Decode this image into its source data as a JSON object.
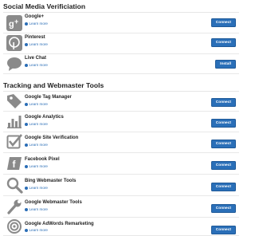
{
  "colors": {
    "accent": "#2a6fb8",
    "icon_gray": "#8a8a8a",
    "link_blue": "#2a6db6"
  },
  "social": {
    "title": "Social Media Verificiation",
    "items": [
      {
        "icon": "google-plus-icon",
        "name": "Google+",
        "learn": "Learn more",
        "action": "Connect"
      },
      {
        "icon": "pinterest-icon",
        "name": "Pinterest",
        "learn": "Learn more",
        "action": "Connect"
      },
      {
        "icon": "chat-bubble-icon",
        "name": "Live Chat",
        "learn": "Learn more",
        "action": "Install"
      }
    ]
  },
  "tracking": {
    "title": "Tracking and Webmaster Tools",
    "items": [
      {
        "icon": "tag-icon",
        "name": "Google Tag Manager",
        "learn": "Learn more",
        "action": "Connect"
      },
      {
        "icon": "bar-chart-icon",
        "name": "Google Analytics",
        "learn": "Learn more",
        "action": "Connect"
      },
      {
        "icon": "checkbox-icon",
        "name": "Google Site Verification",
        "learn": "Learn more",
        "action": "Connect"
      },
      {
        "icon": "facebook-icon",
        "name": "Facebook Pixel",
        "learn": "Learn more",
        "action": "Connect"
      },
      {
        "icon": "magnifier-icon",
        "name": "Bing Webmaster Tools",
        "learn": "Learn more",
        "action": "Connect"
      },
      {
        "icon": "wrench-icon",
        "name": "Google Webmaster Tools",
        "learn": "Learn more",
        "action": "Connect"
      },
      {
        "icon": "target-icon",
        "name": "Google AdWords Remarketing",
        "learn": "Learn more",
        "action": "Connect"
      }
    ]
  }
}
